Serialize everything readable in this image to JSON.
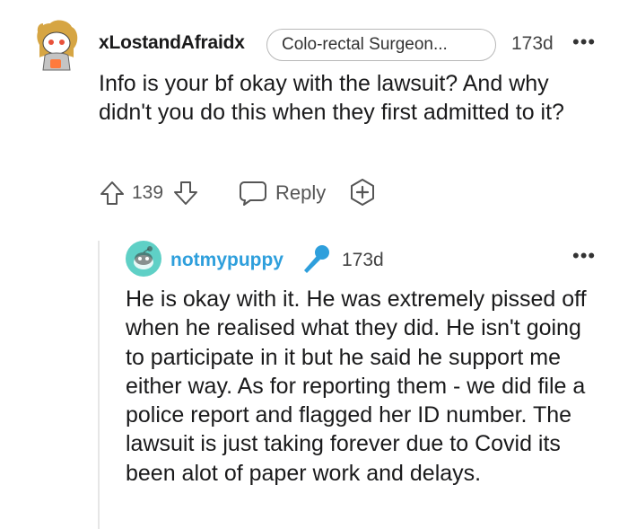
{
  "comment": {
    "username": "xLostandAfraidx",
    "flair": "Colo-rectal Surgeon...",
    "time": "173d",
    "more": "•••",
    "body": "Info is your bf okay with the lawsuit? And why didn't you do this when they first admitted to it?",
    "score": "139",
    "reply_label": "Reply"
  },
  "reply": {
    "username": "notmypuppy",
    "time": "173d",
    "more": "•••",
    "body": "He is okay with it. He was extremely pissed off when he realised what they did. He isn't going to participate in it but he said he support me either way. As for reporting them - we did file a police report and flagged her ID number. The lawsuit is just taking forever due to Covid its been alot of paper work and delays."
  },
  "icons": {
    "upvote": "arrow-up-icon",
    "downvote": "arrow-down-icon",
    "reply": "speech-bubble-icon",
    "award": "award-plus-icon",
    "flair_icon": "microphone-icon"
  },
  "colors": {
    "reply_username": "#2e9fdc",
    "mic_icon": "#2e9fdc",
    "avatar2_bg": "#5fd0c6",
    "thread_line": "#e6e6e6"
  }
}
